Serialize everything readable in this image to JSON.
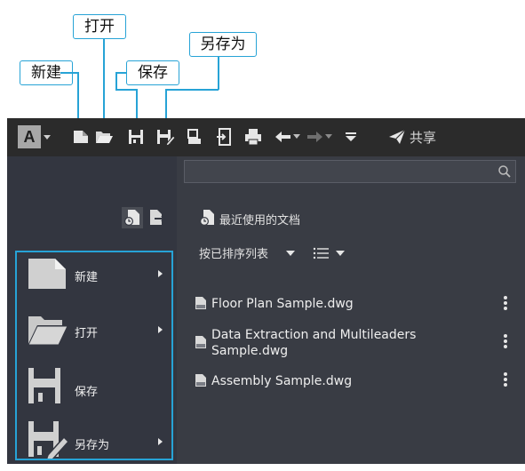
{
  "callouts": {
    "new": "新建",
    "open": "打开",
    "save": "保存",
    "save_as": "另存为"
  },
  "app": {
    "logo_letter": "A",
    "share_label": "共享"
  },
  "toolbar_icons": [
    "app-menu-icon",
    "new-icon",
    "open-icon",
    "save-icon",
    "save-as-icon",
    "plot-icon",
    "export-icon",
    "print-icon",
    "undo-icon",
    "redo-icon",
    "customize-icon",
    "share-icon"
  ],
  "search": {
    "placeholder": ""
  },
  "recent": {
    "title": "最近使用的文档",
    "sort_label": "按已排序列表",
    "files": [
      "Floor Plan Sample.dwg",
      "Data Extraction and Multileaders Sample.dwg",
      "Assembly Sample.dwg"
    ]
  },
  "menu": {
    "items": [
      {
        "label": "新建",
        "has_submenu": true
      },
      {
        "label": "打开",
        "has_submenu": true
      },
      {
        "label": "保存",
        "has_submenu": false
      },
      {
        "label": "另存为",
        "has_submenu": true
      }
    ]
  },
  "colors": {
    "accent": "#27a3d6",
    "toolbar": "#2b2b2b",
    "pane": "#393c44"
  }
}
